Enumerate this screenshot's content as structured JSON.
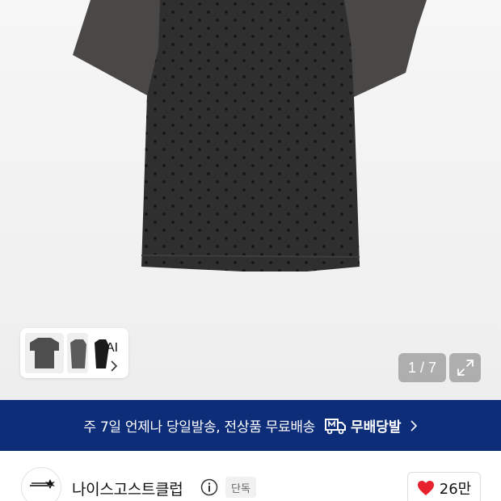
{
  "gallery": {
    "product_image": "dotted-mesh-raglan-tshirt",
    "ai_label": "AI",
    "page_counter": "1 / 7"
  },
  "promo": {
    "text": "주 7일 언제나 당일발송, 전상품 무료배송",
    "brand_label": "무배당발",
    "accent_color": "#0d2d79"
  },
  "store": {
    "name": "나이스고스트클럽",
    "badge": "단독",
    "likes": "26만",
    "heart_color": "#e8212e"
  },
  "icons": [
    "expand-icon",
    "chevron-right-icon",
    "delivery-truck-icon",
    "info-icon",
    "heart-icon"
  ]
}
